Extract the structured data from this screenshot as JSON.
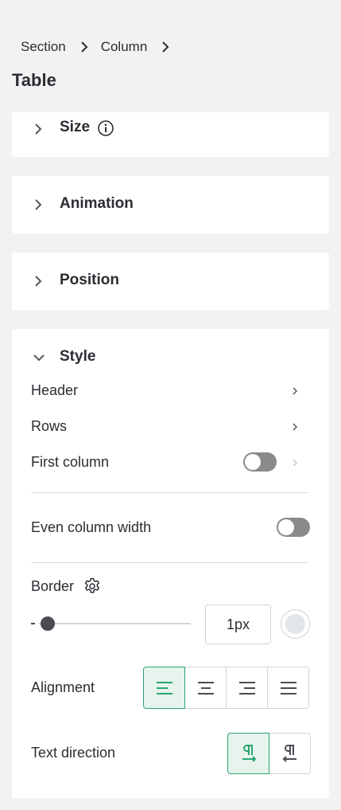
{
  "breadcrumb": {
    "items": [
      "Section",
      "Column"
    ]
  },
  "page_title": "Table",
  "panels": {
    "size": {
      "title": "Size"
    },
    "animation": {
      "title": "Animation"
    },
    "position": {
      "title": "Position"
    },
    "style": {
      "title": "Style",
      "header_label": "Header",
      "rows_label": "Rows",
      "first_column_label": "First column",
      "first_column_on": false,
      "even_column_width_label": "Even column width",
      "even_column_width_on": false,
      "border_label": "Border",
      "border_width_value": "1px",
      "border_slider_level": 0.01,
      "border_color": "#e2e6ea",
      "alignment_label": "Alignment",
      "alignment_selected": "left",
      "text_direction_label": "Text direction",
      "text_direction_selected": "ltr"
    }
  },
  "colors": {
    "accent": "#2aa66f",
    "accent_bg": "#e6f4ed"
  },
  "icons": {
    "breadcrumb_separator": "chevron-right-icon",
    "collapsed": "chevron-right-icon",
    "expanded": "chevron-down-icon",
    "info": "info-icon",
    "settings": "gear-icon"
  }
}
